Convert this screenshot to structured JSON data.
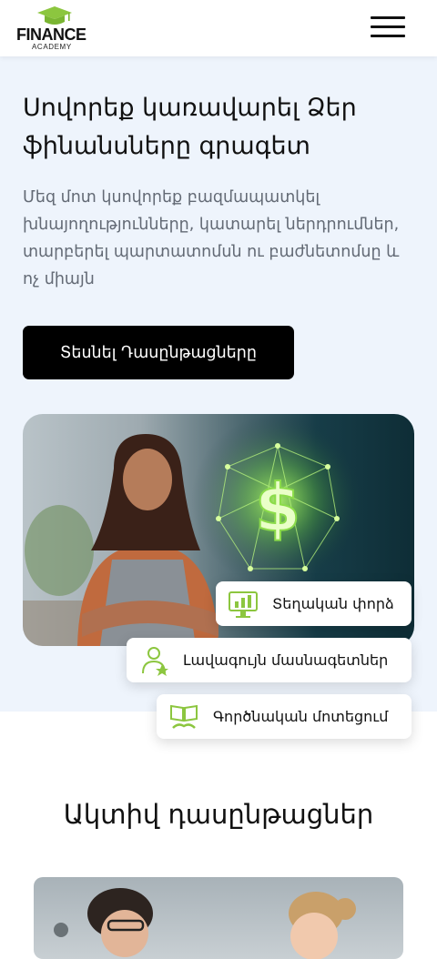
{
  "header": {
    "logo_text": "FINANCE",
    "logo_sub": "ACADEMY",
    "logo_icon": "graduation-cap-icon",
    "menu_icon": "hamburger-menu-icon"
  },
  "hero": {
    "title": "Սովորեք կառավարել Ձեր ֆինանսները գրագետ",
    "description": "Մեզ մոտ կսովորեք բազմապատկել խնայողությունները, կատարել ներդրումներ, տարբերել պարտատոմսն ու բաժնետոմսը և ոչ միայն",
    "cta_label": "Տեսնել Դասընթացները"
  },
  "badges": [
    {
      "label": "Տեղական փորձ",
      "icon": "monitor-chart-icon"
    },
    {
      "label": "Լավագույն մասնագետներ",
      "icon": "experts-star-icon"
    },
    {
      "label": "Գործնական մոտեցում",
      "icon": "book-handshake-icon"
    }
  ],
  "courses": {
    "title": "Ակտիվ  դասընթացներ"
  },
  "colors": {
    "accent_green": "#8cc63f",
    "hero_bg": "#eef4fc",
    "button_bg": "#000000"
  }
}
